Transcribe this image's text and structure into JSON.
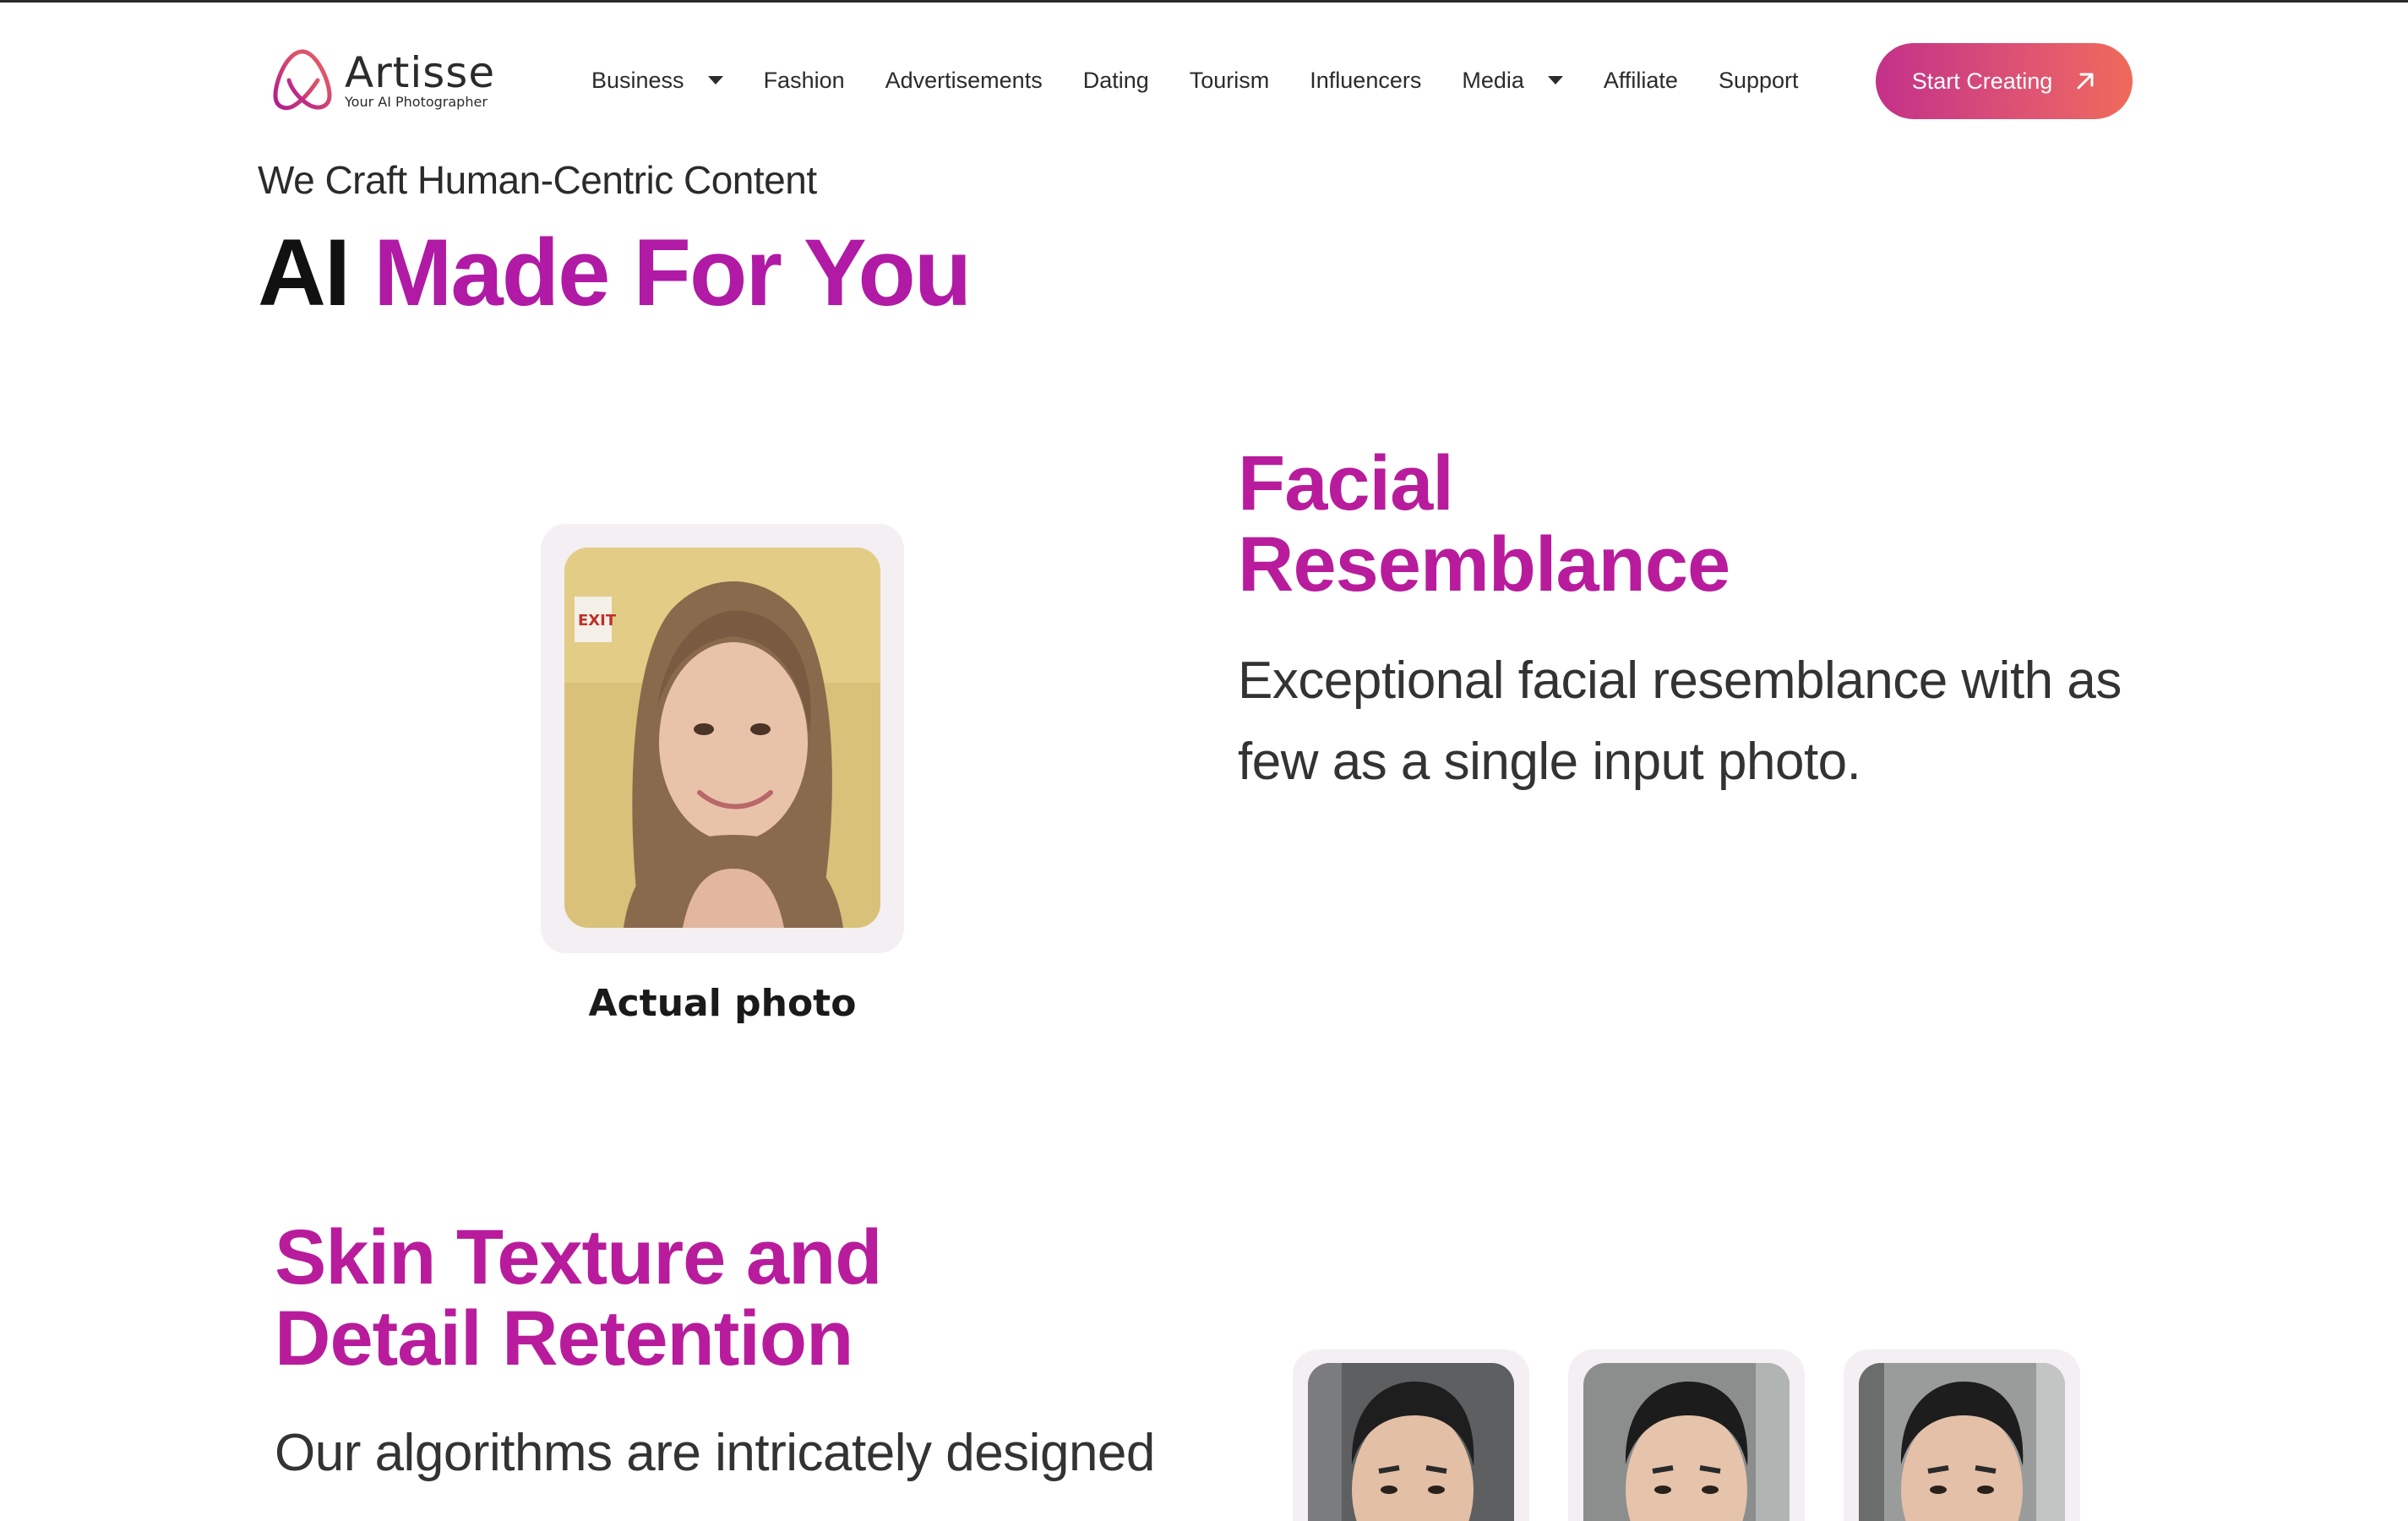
{
  "header": {
    "logo_name": "Artisse",
    "logo_tagline": "Your AI Photographer",
    "nav": [
      {
        "label": "Business",
        "dropdown": true
      },
      {
        "label": "Fashion",
        "dropdown": false
      },
      {
        "label": "Advertisements",
        "dropdown": false
      },
      {
        "label": "Dating",
        "dropdown": false
      },
      {
        "label": "Tourism",
        "dropdown": false
      },
      {
        "label": "Influencers",
        "dropdown": false
      },
      {
        "label": "Media",
        "dropdown": true
      },
      {
        "label": "Affiliate",
        "dropdown": false
      },
      {
        "label": "Support",
        "dropdown": false
      }
    ],
    "cta_label": "Start Creating"
  },
  "hero": {
    "tagline": "We Craft Human-Centric Content",
    "title_plain": "AI",
    "title_accent": "Made For You"
  },
  "sections": [
    {
      "title_line1": "Facial",
      "title_line2": "Resemblance",
      "description": "Exceptional facial resemblance with as few as a single input photo.",
      "photo_caption": "Actual photo"
    },
    {
      "title_line1": "Skin Texture and",
      "title_line2": "Detail Retention",
      "description": "Our algorithms are intricately designed"
    }
  ],
  "colors": {
    "accent": "#b81c9c",
    "cta_gradient_start": "#c3318a",
    "cta_gradient_end": "#ef6a5a"
  },
  "icons": {
    "cta_icon": "arrow-up-right-icon",
    "dropdown_icon": "caret-down-icon"
  }
}
